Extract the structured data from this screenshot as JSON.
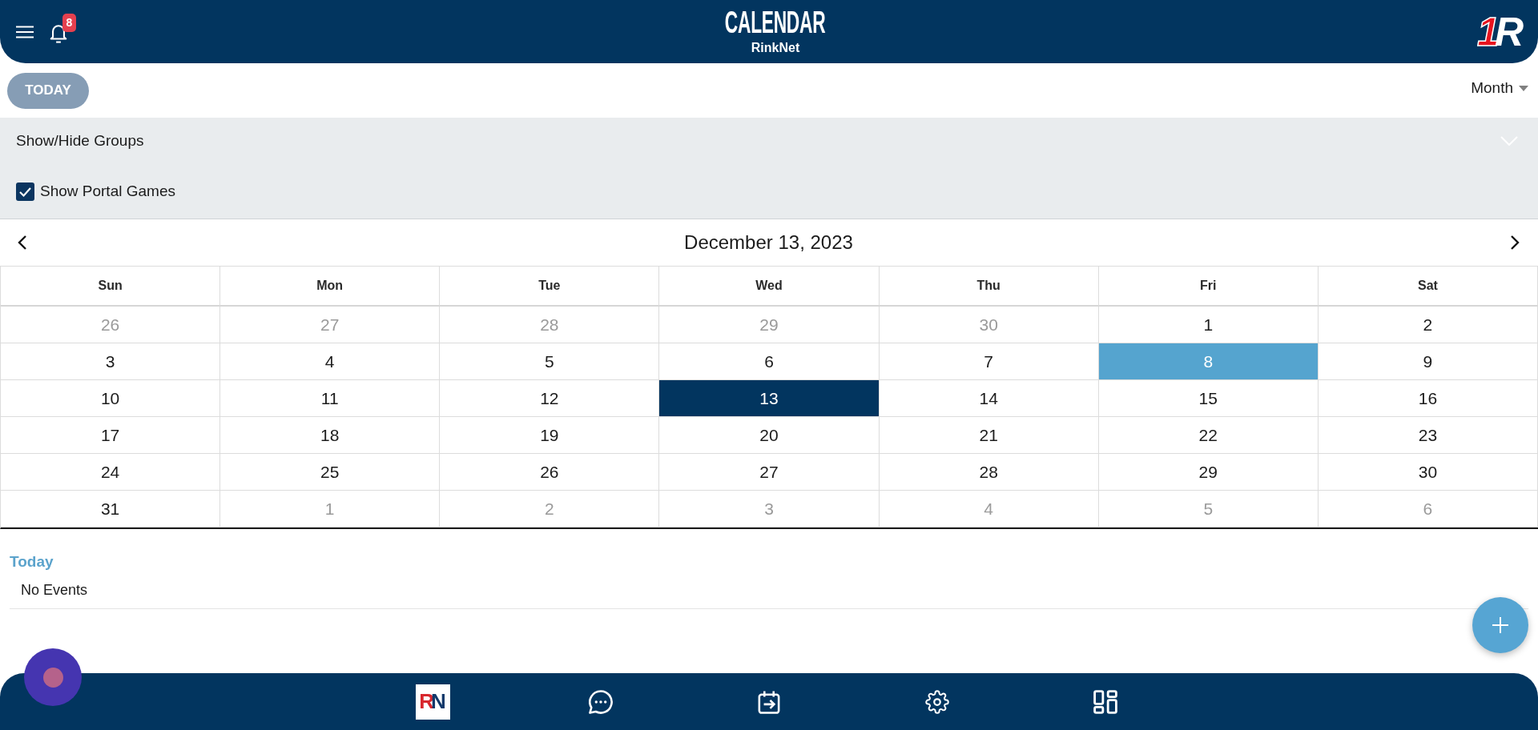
{
  "header": {
    "title": "CALENDAR",
    "subtitle": "RinkNet",
    "notification_count": "8",
    "logo": {
      "mark": "1",
      "letter": "R"
    }
  },
  "toolbar": {
    "today_button": {
      "label": "TODAY",
      "disabled": true
    },
    "view_select": {
      "value": "Month"
    }
  },
  "groups_panel": {
    "title": "Show/Hide Groups",
    "options": [
      {
        "label": "Show Portal Games",
        "checked": true
      }
    ]
  },
  "calendar": {
    "title": "December 13, 2023",
    "weekdays": [
      "Sun",
      "Mon",
      "Tue",
      "Wed",
      "Thu",
      "Fri",
      "Sat"
    ],
    "weeks": [
      [
        {
          "label": "26",
          "other_month": true,
          "selected": false,
          "highlighted": false
        },
        {
          "label": "27",
          "other_month": true,
          "selected": false,
          "highlighted": false
        },
        {
          "label": "28",
          "other_month": true,
          "selected": false,
          "highlighted": false
        },
        {
          "label": "29",
          "other_month": true,
          "selected": false,
          "highlighted": false
        },
        {
          "label": "30",
          "other_month": true,
          "selected": false,
          "highlighted": false
        },
        {
          "label": "1",
          "other_month": false,
          "selected": false,
          "highlighted": false
        },
        {
          "label": "2",
          "other_month": false,
          "selected": false,
          "highlighted": false
        }
      ],
      [
        {
          "label": "3",
          "other_month": false,
          "selected": false,
          "highlighted": false
        },
        {
          "label": "4",
          "other_month": false,
          "selected": false,
          "highlighted": false
        },
        {
          "label": "5",
          "other_month": false,
          "selected": false,
          "highlighted": false
        },
        {
          "label": "6",
          "other_month": false,
          "selected": false,
          "highlighted": false
        },
        {
          "label": "7",
          "other_month": false,
          "selected": false,
          "highlighted": false
        },
        {
          "label": "8",
          "other_month": false,
          "selected": false,
          "highlighted": true
        },
        {
          "label": "9",
          "other_month": false,
          "selected": false,
          "highlighted": false
        }
      ],
      [
        {
          "label": "10",
          "other_month": false,
          "selected": false,
          "highlighted": false
        },
        {
          "label": "11",
          "other_month": false,
          "selected": false,
          "highlighted": false
        },
        {
          "label": "12",
          "other_month": false,
          "selected": false,
          "highlighted": false
        },
        {
          "label": "13",
          "other_month": false,
          "selected": true,
          "highlighted": false
        },
        {
          "label": "14",
          "other_month": false,
          "selected": false,
          "highlighted": false
        },
        {
          "label": "15",
          "other_month": false,
          "selected": false,
          "highlighted": false
        },
        {
          "label": "16",
          "other_month": false,
          "selected": false,
          "highlighted": false
        }
      ],
      [
        {
          "label": "17",
          "other_month": false,
          "selected": false,
          "highlighted": false
        },
        {
          "label": "18",
          "other_month": false,
          "selected": false,
          "highlighted": false
        },
        {
          "label": "19",
          "other_month": false,
          "selected": false,
          "highlighted": false
        },
        {
          "label": "20",
          "other_month": false,
          "selected": false,
          "highlighted": false
        },
        {
          "label": "21",
          "other_month": false,
          "selected": false,
          "highlighted": false
        },
        {
          "label": "22",
          "other_month": false,
          "selected": false,
          "highlighted": false
        },
        {
          "label": "23",
          "other_month": false,
          "selected": false,
          "highlighted": false
        }
      ],
      [
        {
          "label": "24",
          "other_month": false,
          "selected": false,
          "highlighted": false
        },
        {
          "label": "25",
          "other_month": false,
          "selected": false,
          "highlighted": false
        },
        {
          "label": "26",
          "other_month": false,
          "selected": false,
          "highlighted": false
        },
        {
          "label": "27",
          "other_month": false,
          "selected": false,
          "highlighted": false
        },
        {
          "label": "28",
          "other_month": false,
          "selected": false,
          "highlighted": false
        },
        {
          "label": "29",
          "other_month": false,
          "selected": false,
          "highlighted": false
        },
        {
          "label": "30",
          "other_month": false,
          "selected": false,
          "highlighted": false
        }
      ],
      [
        {
          "label": "31",
          "other_month": false,
          "selected": false,
          "highlighted": false
        },
        {
          "label": "1",
          "other_month": true,
          "selected": false,
          "highlighted": false
        },
        {
          "label": "2",
          "other_month": true,
          "selected": false,
          "highlighted": false
        },
        {
          "label": "3",
          "other_month": true,
          "selected": false,
          "highlighted": false
        },
        {
          "label": "4",
          "other_month": true,
          "selected": false,
          "highlighted": false
        },
        {
          "label": "5",
          "other_month": true,
          "selected": false,
          "highlighted": false
        },
        {
          "label": "6",
          "other_month": true,
          "selected": false,
          "highlighted": false
        }
      ]
    ]
  },
  "events": {
    "heading": "Today",
    "message": "No Events"
  },
  "bottom_nav": {
    "logo": {
      "first": "R",
      "second": "N"
    }
  }
}
